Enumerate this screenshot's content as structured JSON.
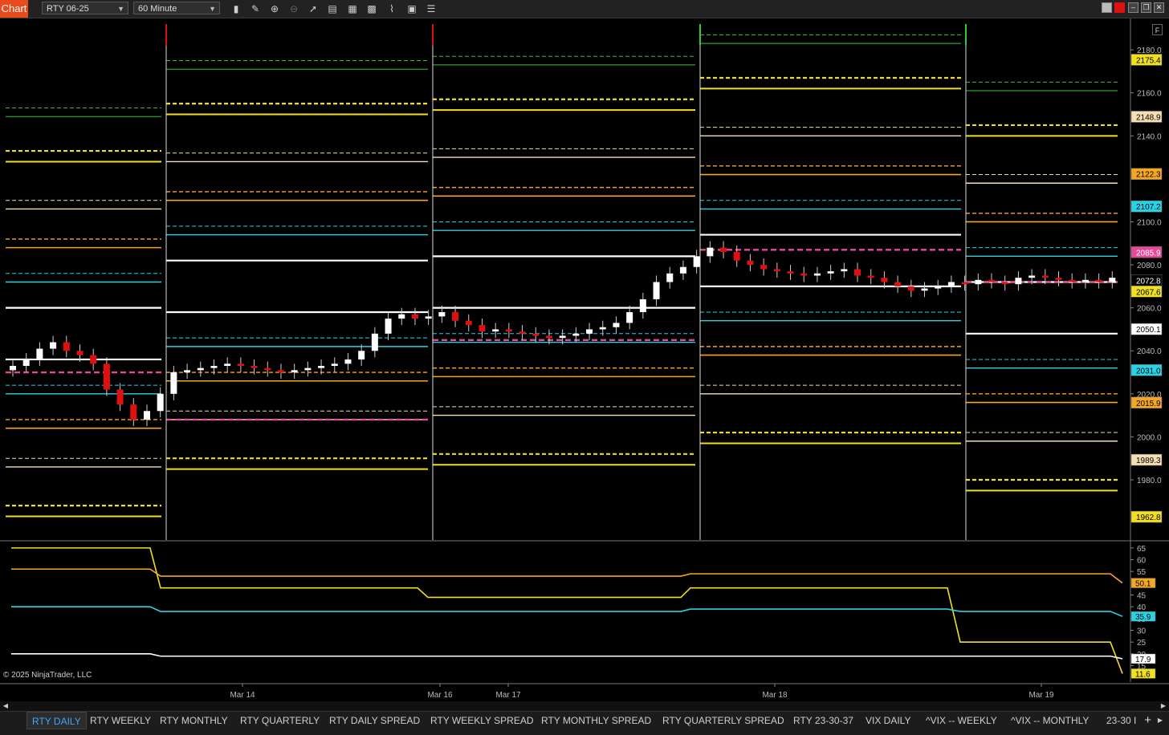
{
  "toolbar": {
    "chart_tab": "Chart",
    "instrument": "RTY 06-25",
    "interval": "60 Minute",
    "icons": [
      "bar-type-icon",
      "drawing-tool-icon",
      "zoom-in-icon",
      "zoom-out-icon",
      "pointer-icon",
      "data-box-icon",
      "properties-icon",
      "templates-icon",
      "strategy-icon",
      "indicator-icon",
      "list-icon"
    ]
  },
  "chart": {
    "copyright": "© 2025 NinjaTrader, LLC",
    "panel_label": "F",
    "price_axis": {
      "min": 1952,
      "max": 2192,
      "ticks": [
        2180,
        2160,
        2140,
        2100,
        2080,
        2060,
        2040,
        2020,
        2000,
        1980
      ]
    },
    "price_badges": [
      {
        "value": "2175.4",
        "bg": "#f0e020",
        "fg": "#000"
      },
      {
        "value": "2148.9",
        "bg": "#f5deb3",
        "fg": "#000"
      },
      {
        "value": "2122.3",
        "bg": "#f5a623",
        "fg": "#000"
      },
      {
        "value": "2107.2",
        "bg": "#29d3e6",
        "fg": "#000"
      },
      {
        "value": "2085.9",
        "bg": "#e8489a",
        "fg": "#fff"
      },
      {
        "value": "2072.8",
        "bg": "#000",
        "fg": "#fff"
      },
      {
        "value": "2067.6",
        "bg": "#f0e020",
        "fg": "#000"
      },
      {
        "value": "2050.1",
        "bg": "#fff",
        "fg": "#000"
      },
      {
        "value": "2031.0",
        "bg": "#29d3e6",
        "fg": "#000"
      },
      {
        "value": "2015.9",
        "bg": "#f5a623",
        "fg": "#000"
      },
      {
        "value": "1989.3",
        "bg": "#f5deb3",
        "fg": "#000"
      },
      {
        "value": "1962.8",
        "bg": "#f0e020",
        "fg": "#000"
      }
    ],
    "indicator_axis": {
      "min": 8,
      "max": 67,
      "ticks": [
        65,
        60,
        55,
        45,
        40,
        35,
        30,
        25,
        20,
        15
      ]
    },
    "indicator_badges": [
      {
        "value": "50.1",
        "bg": "#f5a623",
        "fg": "#000"
      },
      {
        "value": "35.9",
        "bg": "#29d3e6",
        "fg": "#000"
      },
      {
        "value": "17.9",
        "bg": "#fff",
        "fg": "#000"
      },
      {
        "value": "11.6",
        "bg": "#f0e020",
        "fg": "#000"
      }
    ],
    "time_labels": [
      "Mar 14",
      "Mar 16",
      "Mar 17",
      "Mar 18",
      "Mar 19"
    ],
    "colors": {
      "up": "#ffffff",
      "down": "#e01010",
      "yellow": "#f0e020",
      "orange": "#f5a623",
      "cyan": "#29d3e6",
      "white": "#ffffff",
      "wheat": "#f5deb3",
      "magenta": "#e8489a",
      "green": "#35c935",
      "red": "#e01010"
    }
  },
  "bottom_tabs": [
    "RTY DAILY",
    "RTY WEEKLY",
    "RTY MONTHLY",
    "RTY QUARTERLY",
    "RTY DAILY SPREAD",
    "RTY WEEKLY SPREAD",
    "RTY MONTHLY SPREAD",
    "RTY QUARTERLY SPREAD",
    "RTY 23-30-37",
    "VIX DAILY",
    "^VIX -- WEEKLY",
    "^VIX -- MONTHLY",
    "23-30 I"
  ]
}
